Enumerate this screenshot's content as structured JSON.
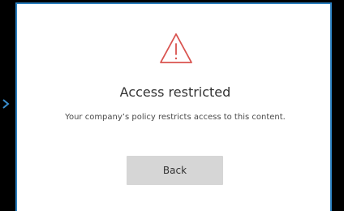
{
  "dialog": {
    "title": "Access restricted",
    "message": "Your company’s policy restricts access to this content.",
    "back_label": "Back",
    "icon": "warning-triangle-icon",
    "accent_color": "#2a7fbf",
    "icon_color": "#d9534f"
  },
  "side_nav": {
    "icon": "chevron-right-icon"
  }
}
